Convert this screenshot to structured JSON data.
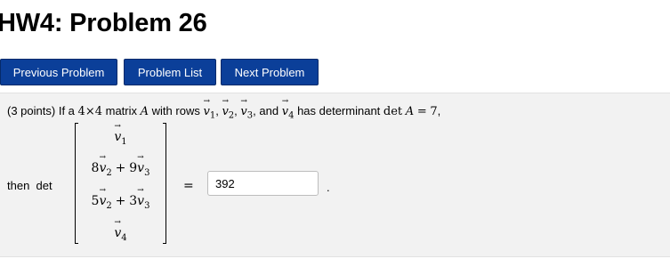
{
  "page": {
    "title": "HW4: Problem 26"
  },
  "nav": {
    "previous_label": "Previous Problem",
    "list_label": "Problem List",
    "next_label": "Next Problem"
  },
  "problem": {
    "points": "(3 points)",
    "intro_if": "If a",
    "n1": "4",
    "times": "×",
    "n2": "4",
    "matrix_word": "matrix",
    "A": "A",
    "with_rows": "with rows",
    "v1_sub": "1",
    "v2_sub": "2",
    "v3_sub": "3",
    "v4_sub": "4",
    "and": "and",
    "has_det": "has determinant",
    "det": "det",
    "eq": "=",
    "det_value": "7",
    "then": "then",
    "then_det": "det",
    "rows": {
      "r1_sub": "1",
      "r2_c1": "8",
      "r2_sub1": "2",
      "r2_plus": "+",
      "r2_c2": "9",
      "r2_sub2": "3",
      "r3_c1": "5",
      "r3_sub1": "2",
      "r3_plus": "+",
      "r3_c2": "3",
      "r3_sub2": "3",
      "r4_sub": "4"
    },
    "equals": "=",
    "answer_value": "392",
    "period": "."
  }
}
